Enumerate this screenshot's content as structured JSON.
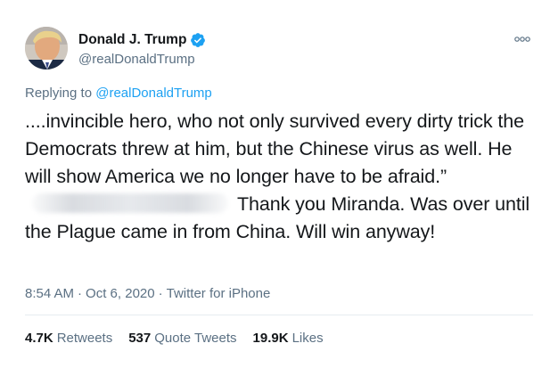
{
  "tweet": {
    "author": {
      "display_name": "Donald J. Trump",
      "handle": "@realDonaldTrump",
      "verified": true,
      "verified_icon": "verified-badge-icon",
      "avatar_icon": "profile-avatar"
    },
    "more_icon": "more-options-icon",
    "replying_prefix": "Replying to",
    "replying_handle": "@realDonaldTrump",
    "text_part1": "....invincible hero, who not only survived every dirty trick the Democrats threw at him, but the Chinese virus as well. He will show America we no longer have to be afraid.”",
    "text_part2": "Thank you Miranda. Was over until the Plague came in from China. Will win anyway!",
    "time": "8:54 AM",
    "date": "Oct 6, 2020",
    "source": "Twitter for iPhone",
    "stats": {
      "retweets_count": "4.7K",
      "retweets_label": "Retweets",
      "quote_count": "537",
      "quote_label": "Quote Tweets",
      "likes_count": "19.9K",
      "likes_label": "Likes"
    },
    "colors": {
      "link": "#1da1f2",
      "secondary_text": "#5b7083",
      "primary_text": "#14171a"
    }
  }
}
